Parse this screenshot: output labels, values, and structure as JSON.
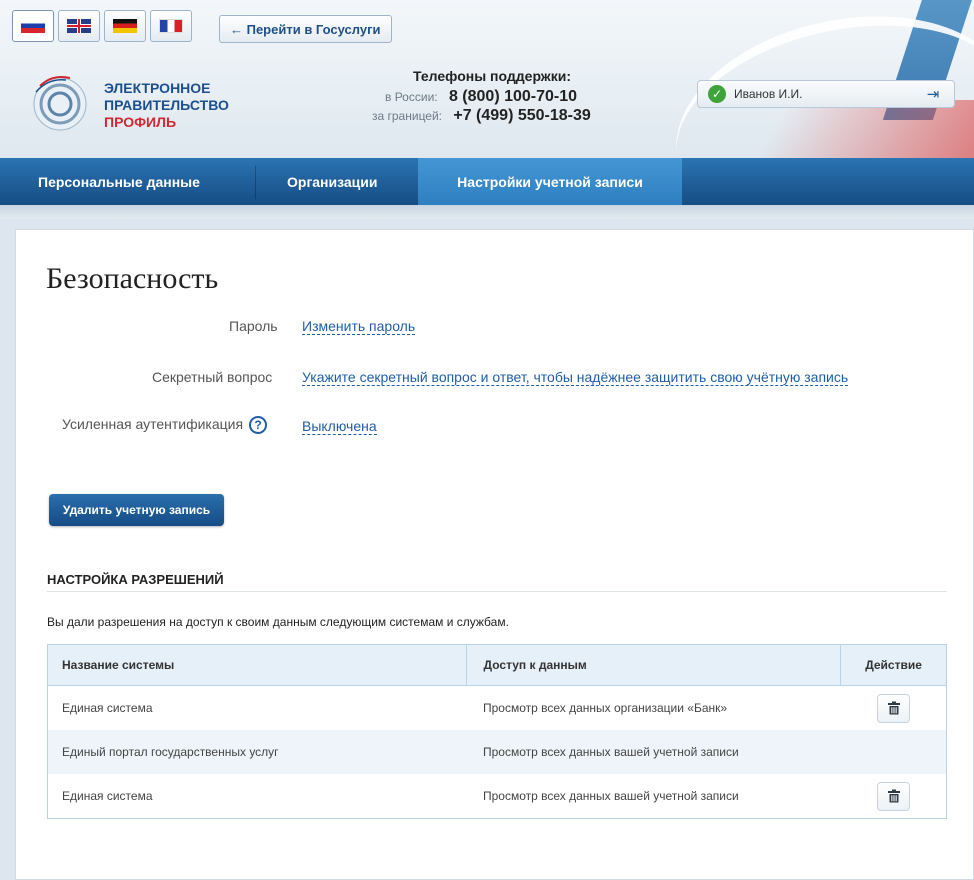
{
  "header": {
    "languages": [
      {
        "code": "ru",
        "icon": "flag-ru-icon",
        "active": true
      },
      {
        "code": "en",
        "icon": "flag-uk-icon",
        "active": false
      },
      {
        "code": "de",
        "icon": "flag-de-icon",
        "active": false
      },
      {
        "code": "fr",
        "icon": "flag-fr-icon",
        "active": false
      }
    ],
    "goto_label": "← Перейти в Госуслуги",
    "logo": {
      "line1": "ЭЛЕКТРОННОЕ",
      "line2": "ПРАВИТЕЛЬСТВО",
      "line3": "ПРОФИЛЬ"
    },
    "support": {
      "title": "Телефоны поддержки:",
      "russia_label": "в России:",
      "russia_phone": "8 (800) 100-70-10",
      "abroad_label": "за границей:",
      "abroad_phone": "+7 (499) 550-18-39"
    },
    "user": {
      "name": "Иванов И.И.",
      "status_icon": "check-icon",
      "logout_icon": "logout-icon"
    }
  },
  "nav": {
    "items": [
      {
        "label": "Персональные данные",
        "active": false
      },
      {
        "label": "Организации",
        "active": false
      },
      {
        "label": "Настройки учетной записи",
        "active": true
      }
    ]
  },
  "security": {
    "title": "Безопасность",
    "password_label": "Пароль",
    "password_link": "Изменить пароль",
    "secret_label": "Секретный вопрос",
    "secret_link": "Укажите секретный вопрос и ответ, чтобы надёжнее защитить свою учётную запись",
    "auth_label": "Усиленная аутентификация",
    "auth_help": "?",
    "auth_link": "Выключена",
    "delete_button": "Удалить учетную запись"
  },
  "permissions": {
    "title": "НАСТРОЙКА РАЗРЕШЕНИЙ",
    "description": "Вы дали разрешения на доступ к своим данным следующим системам и службам.",
    "columns": [
      "Название системы",
      "Доступ к данным",
      "Действие"
    ],
    "rows": [
      {
        "system": "Единая система",
        "access": "Просмотр всех данных организации «Банк»",
        "deletable": true
      },
      {
        "system": "Единый портал государственных услуг",
        "access": "Просмотр всех данных вашей учетной записи",
        "deletable": false
      },
      {
        "system": "Единая система",
        "access": "Просмотр всех данных вашей учетной записи",
        "deletable": true
      }
    ]
  },
  "colors": {
    "brand_blue": "#1f5e99",
    "accent_red": "#d12832",
    "link": "#1f5ea6"
  }
}
